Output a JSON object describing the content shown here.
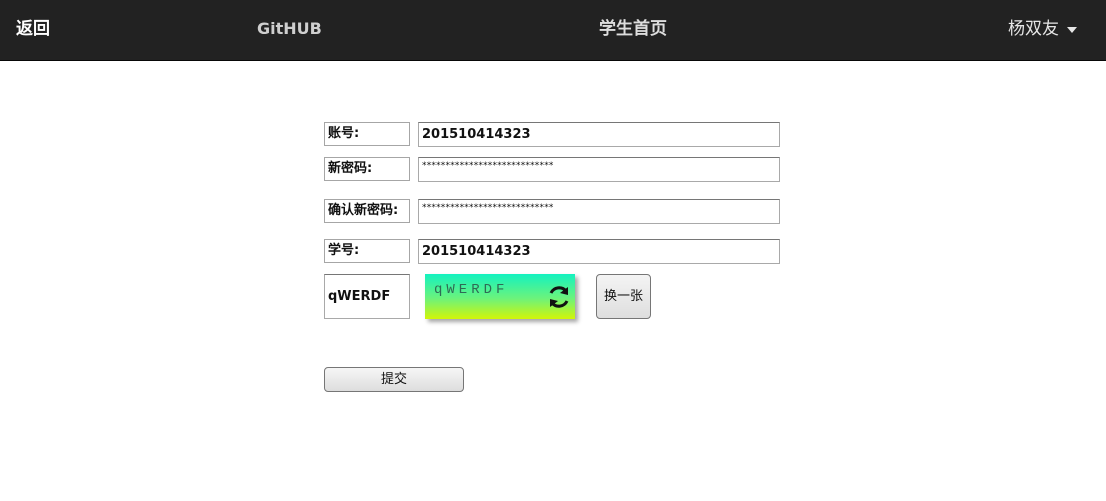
{
  "navbar": {
    "back_label": "返回",
    "github_label": "GitHUB",
    "title": "学生首页",
    "user_name": "杨双友",
    "caret_icon": "caret-down-icon"
  },
  "form": {
    "account": {
      "label": "账号:",
      "value": "201510414323"
    },
    "new_password": {
      "label": "新密码:",
      "value": "****************************"
    },
    "confirm_password": {
      "label": "确认新密码:",
      "value": "****************************"
    },
    "student_id": {
      "label": "学号:",
      "value": "201510414323"
    },
    "captcha": {
      "input_value": "qWERDF",
      "image_text": "qWERDF",
      "refresh_icon": "refresh-icon",
      "swap_label": "换一张",
      "gradient_colors": [
        "#14f2c0",
        "#6df37a",
        "#d2f507"
      ]
    },
    "submit_label": "提交"
  },
  "colors": {
    "navbar_bg": "#222222",
    "navbar_text": "#dddddd",
    "page_bg": "#ffffff"
  }
}
